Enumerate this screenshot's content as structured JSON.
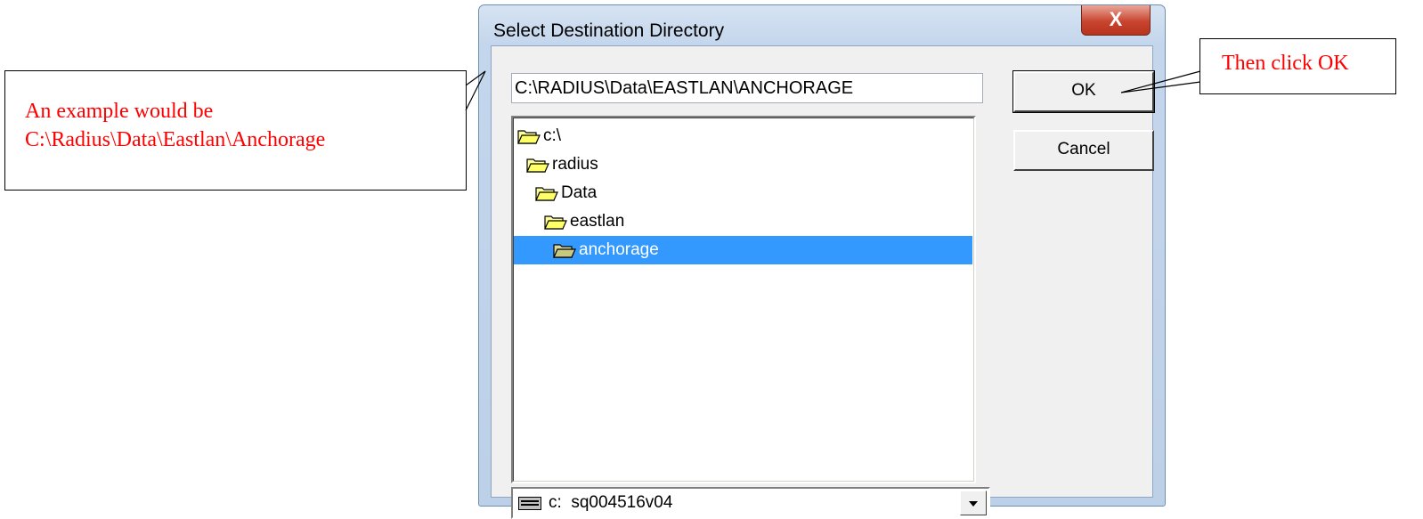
{
  "callouts": {
    "left_line1": "An example would be",
    "left_line2": "C:\\Radius\\Data\\Eastlan\\Anchorage",
    "right": "Then click OK"
  },
  "dialog": {
    "title": "Select Destination Directory",
    "close_glyph": "X",
    "path_value": "C:\\RADIUS\\Data\\EASTLAN\\ANCHORAGE",
    "ok_label": "OK",
    "cancel_label": "Cancel",
    "folders": [
      {
        "label": "c:\\",
        "depth": 0,
        "selected": false
      },
      {
        "label": "radius",
        "depth": 1,
        "selected": false
      },
      {
        "label": "Data",
        "depth": 2,
        "selected": false
      },
      {
        "label": "eastlan",
        "depth": 3,
        "selected": false
      },
      {
        "label": "anchorage",
        "depth": 4,
        "selected": true
      }
    ],
    "drive": {
      "letter": "c:",
      "name": "sq004516v04",
      "icon": "drive-icon"
    }
  },
  "colors": {
    "annotation_text": "#ff0000",
    "selection": "#3399ff",
    "close_button": "#c9452f"
  }
}
